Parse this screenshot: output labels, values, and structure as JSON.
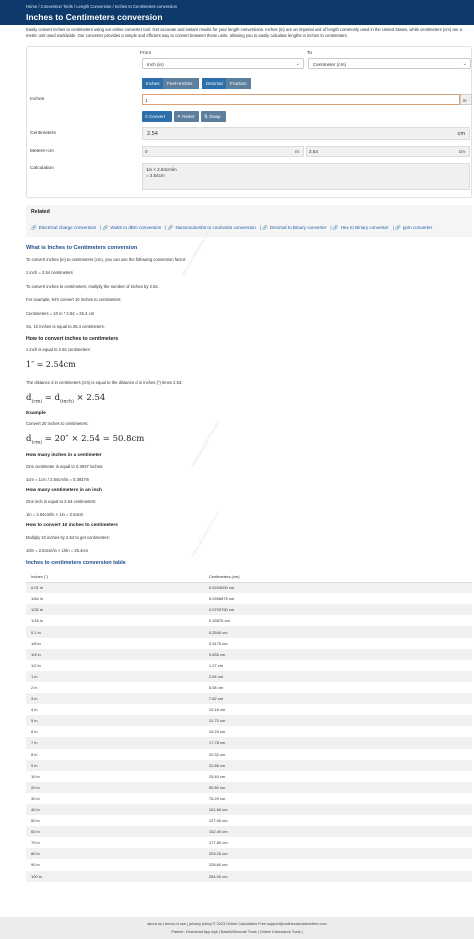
{
  "breadcrumb": [
    "Home",
    "Conversion Tools",
    "Length Conversion",
    "Inches to Centimeters conversion"
  ],
  "page_title": "Inches to Centimeters conversion",
  "intro": "Easily convert inches to centimeters using our online converter tool. Get accurate and instant results for your length conversions. Inches (in) are an imperial unit of length commonly used in the United States, while centimeters (cm) are a metric unit used worldwide. Our converter provides a simple and efficient way to convert between these units, allowing you to easily calculate lengths in inches to centimeters.",
  "converter": {
    "from_label": "From",
    "to_label": "To",
    "from_value": "Inch (in)",
    "to_value": "Centimeter (cm)",
    "input_label": "Inches",
    "toggles": [
      "Inches",
      "Feet+Inches",
      "Decimal",
      "Fraction"
    ],
    "input_value": "1",
    "input_unit": "in",
    "buttons": {
      "convert": "≡ Convert",
      "reset": "✕ Reset",
      "swap": "⇅ Swap"
    },
    "result_label": "Centimeters",
    "result_value": "2.54",
    "result_unit": "cm",
    "mcm_label": "Meters+cm",
    "mcm_m_value": "0",
    "mcm_m_unit": "m",
    "mcm_cm_value": "2.54",
    "mcm_cm_unit": "cm",
    "calc_label": "Calculation",
    "calc_line1": "1in × 2.54cm/in",
    "calc_line2": "= 2.54cm"
  },
  "related": {
    "title": "Related",
    "links": [
      "Electrical charge conversion",
      "Watts to dBm conversion",
      "Nanocoulombs to coulombs conversion",
      "Decimal to Binary converter",
      "Hex to Binary converter",
      "ppm converter"
    ]
  },
  "article": {
    "h_what": "What is Inches to Centimeters conversion",
    "p1": "To convert inches (in) to centimeters (cm), you can use the following conversion factor:",
    "p2": "1 inch = 2.54 centimeters",
    "p3": "To convert inches to centimeters, multiply the number of inches by 2.54.",
    "p4": "For example, let's convert 10 inches to centimeters:",
    "p5": "Centimeters = 10 in * 2.54 = 25.4 cm",
    "p6": "So, 10 inches is equal to 25.4 centimeters.",
    "h_how": "How to convert inches to centimeters",
    "p7": "1 inch is equal to 2.54 centimeters:",
    "eq1": "1″ = 2.54cm",
    "p8": "The distance d in centimeters (cm) is equal to the distance d in inches (″) times 2.54:",
    "eq2_d": "d",
    "eq2_sub1": "(cm)",
    "eq2_mid": " = d",
    "eq2_sub2": "(inch)",
    "eq2_end": " × 2.54",
    "h_example": "Example",
    "p9": "Convert 20 inches to centimeters:",
    "eq3_end": " = 20″ × 2.54 = 50.8cm",
    "h_many_inch": "How many inches in a centimeter",
    "p10": "One centimeter is equal to 0.3937 inches:",
    "p11": "1cm = 1cm / 2.54cm/in = 0.3937in",
    "h_many_cm": "How many centimeters in an inch",
    "p12": "One inch is equal to 2.54 centimeters:",
    "p13": "1in = 2.54cm/in × 1in = 2.54cm",
    "h_ten": "How to convert 10 inches to centimeters",
    "p14": "Multiply 10 inches by 2.54 to get centimeters:",
    "p15": "10in = 2.54cm/in × 10in = 25.4cm",
    "h_table": "Inches to centimeters conversion table"
  },
  "table": {
    "headers": [
      "Inches (\")",
      "Centimeters (cm)"
    ],
    "rows": [
      [
        "0.01 in",
        "0.0254000 cm"
      ],
      [
        "1/64 in",
        "0.0396875 cm"
      ],
      [
        "1/32 in",
        "0.0793750 cm"
      ],
      [
        "1/16 in",
        "0.15875 cm"
      ],
      [
        "0.1 in",
        "0.2540 cm"
      ],
      [
        "1/8 in",
        "0.3175 cm"
      ],
      [
        "1/4 in",
        "0.635 cm"
      ],
      [
        "1/2 in",
        "1.27 cm"
      ],
      [
        "1 in",
        "2.54 cm"
      ],
      [
        "2 in",
        "5.08 cm"
      ],
      [
        "3 in",
        "7.62 cm"
      ],
      [
        "4 in",
        "10.16 cm"
      ],
      [
        "5 in",
        "12.70 cm"
      ],
      [
        "6 in",
        "15.24 cm"
      ],
      [
        "7 in",
        "17.78 cm"
      ],
      [
        "8 in",
        "20.32 cm"
      ],
      [
        "9 in",
        "22.86 cm"
      ],
      [
        "10 in",
        "25.40 cm"
      ],
      [
        "20 in",
        "50.80 cm"
      ],
      [
        "30 in",
        "76.20 cm"
      ],
      [
        "40 in",
        "101.60 cm"
      ],
      [
        "50 in",
        "127.00 cm"
      ],
      [
        "60 in",
        "152.40 cm"
      ],
      [
        "70 in",
        "177.80 cm"
      ],
      [
        "80 in",
        "203.20 cm"
      ],
      [
        "90 in",
        "228.60 cm"
      ],
      [
        "100 in",
        "254.00 cm"
      ]
    ]
  },
  "watermark": "onlinecalculatorsfree.com",
  "footer": {
    "line1": "about us | terms of use | privacy policy  © 2023 Online Calculators Free  support@onlinecalculatorsfree.com",
    "line2": "Partner:  Download App Apk | Base64Decode Tools | Online Calculators Tools |"
  },
  "colors": {
    "header_bg": "#0d3a6b",
    "accent": "#2d6fa8",
    "heading": "#1e4b8c",
    "link": "#1f5fa8"
  }
}
